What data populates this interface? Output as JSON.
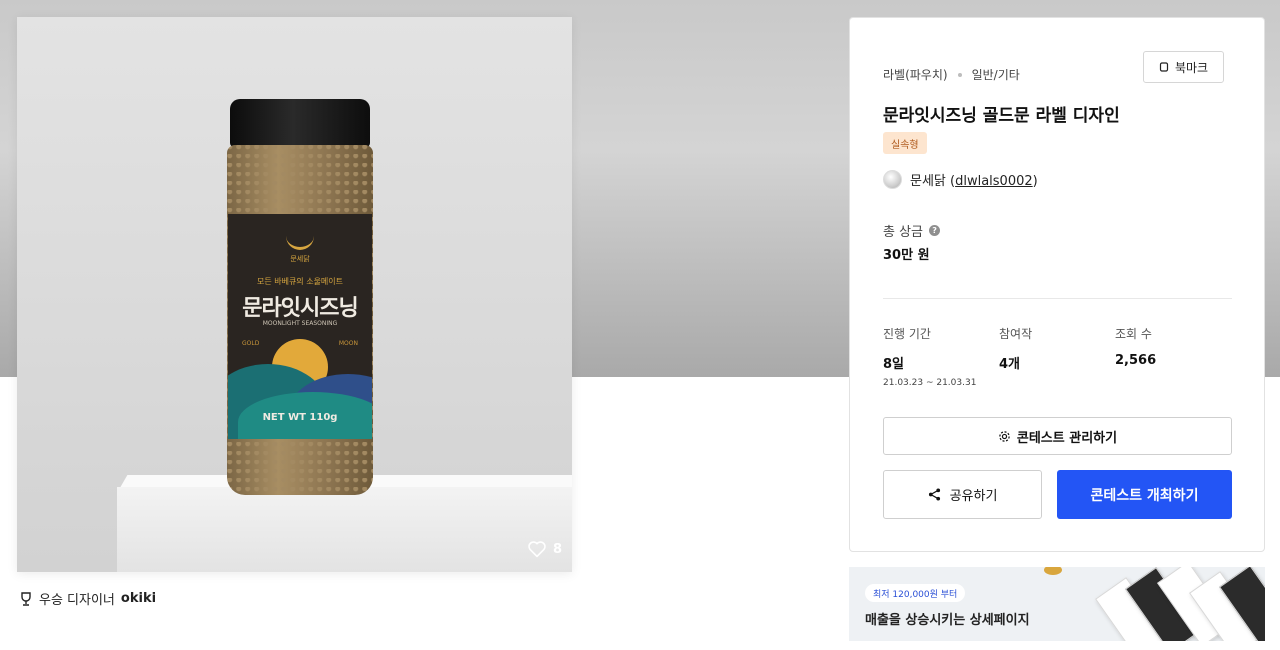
{
  "product": {
    "like_count": "8",
    "label": {
      "brand": "문세닭",
      "tagline": "모든 바베큐의 소울메이트",
      "title": "문라잇시즈닝",
      "subtitle": "MOONLIGHT SEASONING",
      "gold": "GOLD",
      "moon": "MOON",
      "net_weight": "NET WT 110g"
    }
  },
  "winner": {
    "prefix": "우승 디자이너",
    "name": "okiki"
  },
  "contest": {
    "breadcrumb": [
      "라벨(파우치)",
      "일반/기타"
    ],
    "bookmark_label": "북마크",
    "title": "문라잇시즈닝 골드문 라벨 디자인",
    "tag": "실속형",
    "host_name": "문세닭 (",
    "host_id": "dlwlals0002",
    "host_close": ")",
    "prize_label": "총 상금",
    "prize_help": "?",
    "prize_value": "30만 원",
    "stats": {
      "period_label": "진행 기간",
      "period_value": "8일",
      "period_range": "21.03.23 ~ 21.03.31",
      "entries_label": "참여작",
      "entries_value": "4개",
      "views_label": "조회 수",
      "views_value": "2,566"
    },
    "manage_button": "콘테스트 관리하기",
    "share_button": "공유하기",
    "host_button": "콘테스트 개최하기"
  },
  "banner": {
    "badge": "최저 120,000원 부터",
    "text": "매출을 상승시키는 상세페이지"
  },
  "colors": {
    "primary": "#2355f5",
    "tag_bg": "#fde5cf",
    "tag_text": "#b05a1c"
  }
}
